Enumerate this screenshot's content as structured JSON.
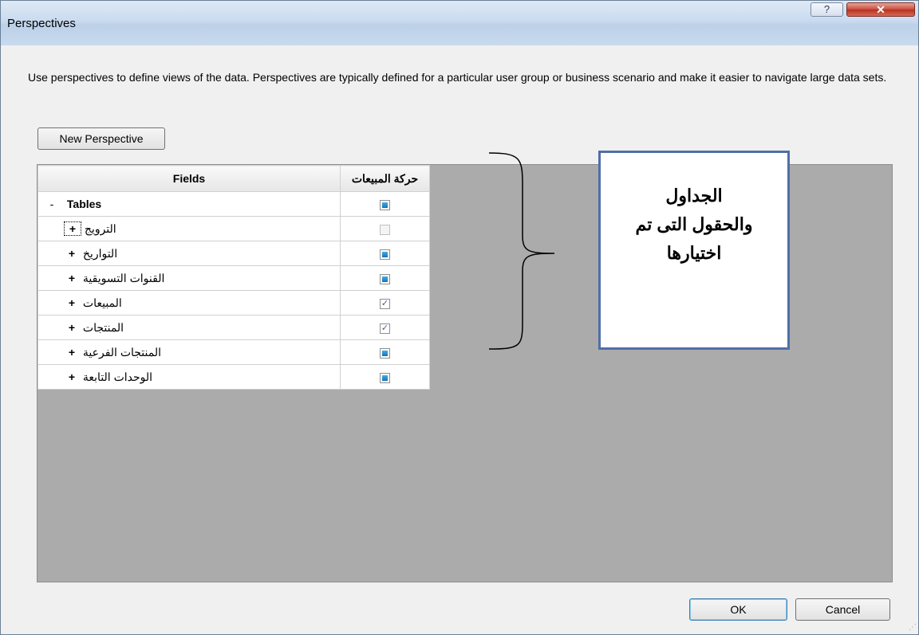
{
  "window": {
    "title": "Perspectives",
    "help_label": "?",
    "close_label": "✕"
  },
  "description": "Use perspectives to define views of the data. Perspectives are typically defined for a particular user group or business scenario and make it easier to navigate large data sets.",
  "new_perspective_label": "New Perspective",
  "grid": {
    "columns": [
      "Fields",
      "حركة المبيعات"
    ],
    "group": {
      "toggle": "-",
      "label": "Tables",
      "state": "indeterminate"
    },
    "rows": [
      {
        "toggle": "+",
        "label": "الترويج",
        "state": "unchecked"
      },
      {
        "toggle": "+",
        "label": "التواريخ",
        "state": "indeterminate"
      },
      {
        "toggle": "+",
        "label": "القنوات التسويقية",
        "state": "indeterminate"
      },
      {
        "toggle": "+",
        "label": "المبيعات",
        "state": "checked"
      },
      {
        "toggle": "+",
        "label": "المنتجات",
        "state": "checked"
      },
      {
        "toggle": "+",
        "label": "المنتجات الفرعية",
        "state": "indeterminate"
      },
      {
        "toggle": "+",
        "label": "الوحدات التابعة",
        "state": "indeterminate"
      }
    ]
  },
  "callout": {
    "lines": [
      "الجداول",
      "والحقول التى تم",
      "اختيارها"
    ],
    "border_color": "#4f6fa7"
  },
  "buttons": {
    "ok": "OK",
    "cancel": "Cancel"
  }
}
